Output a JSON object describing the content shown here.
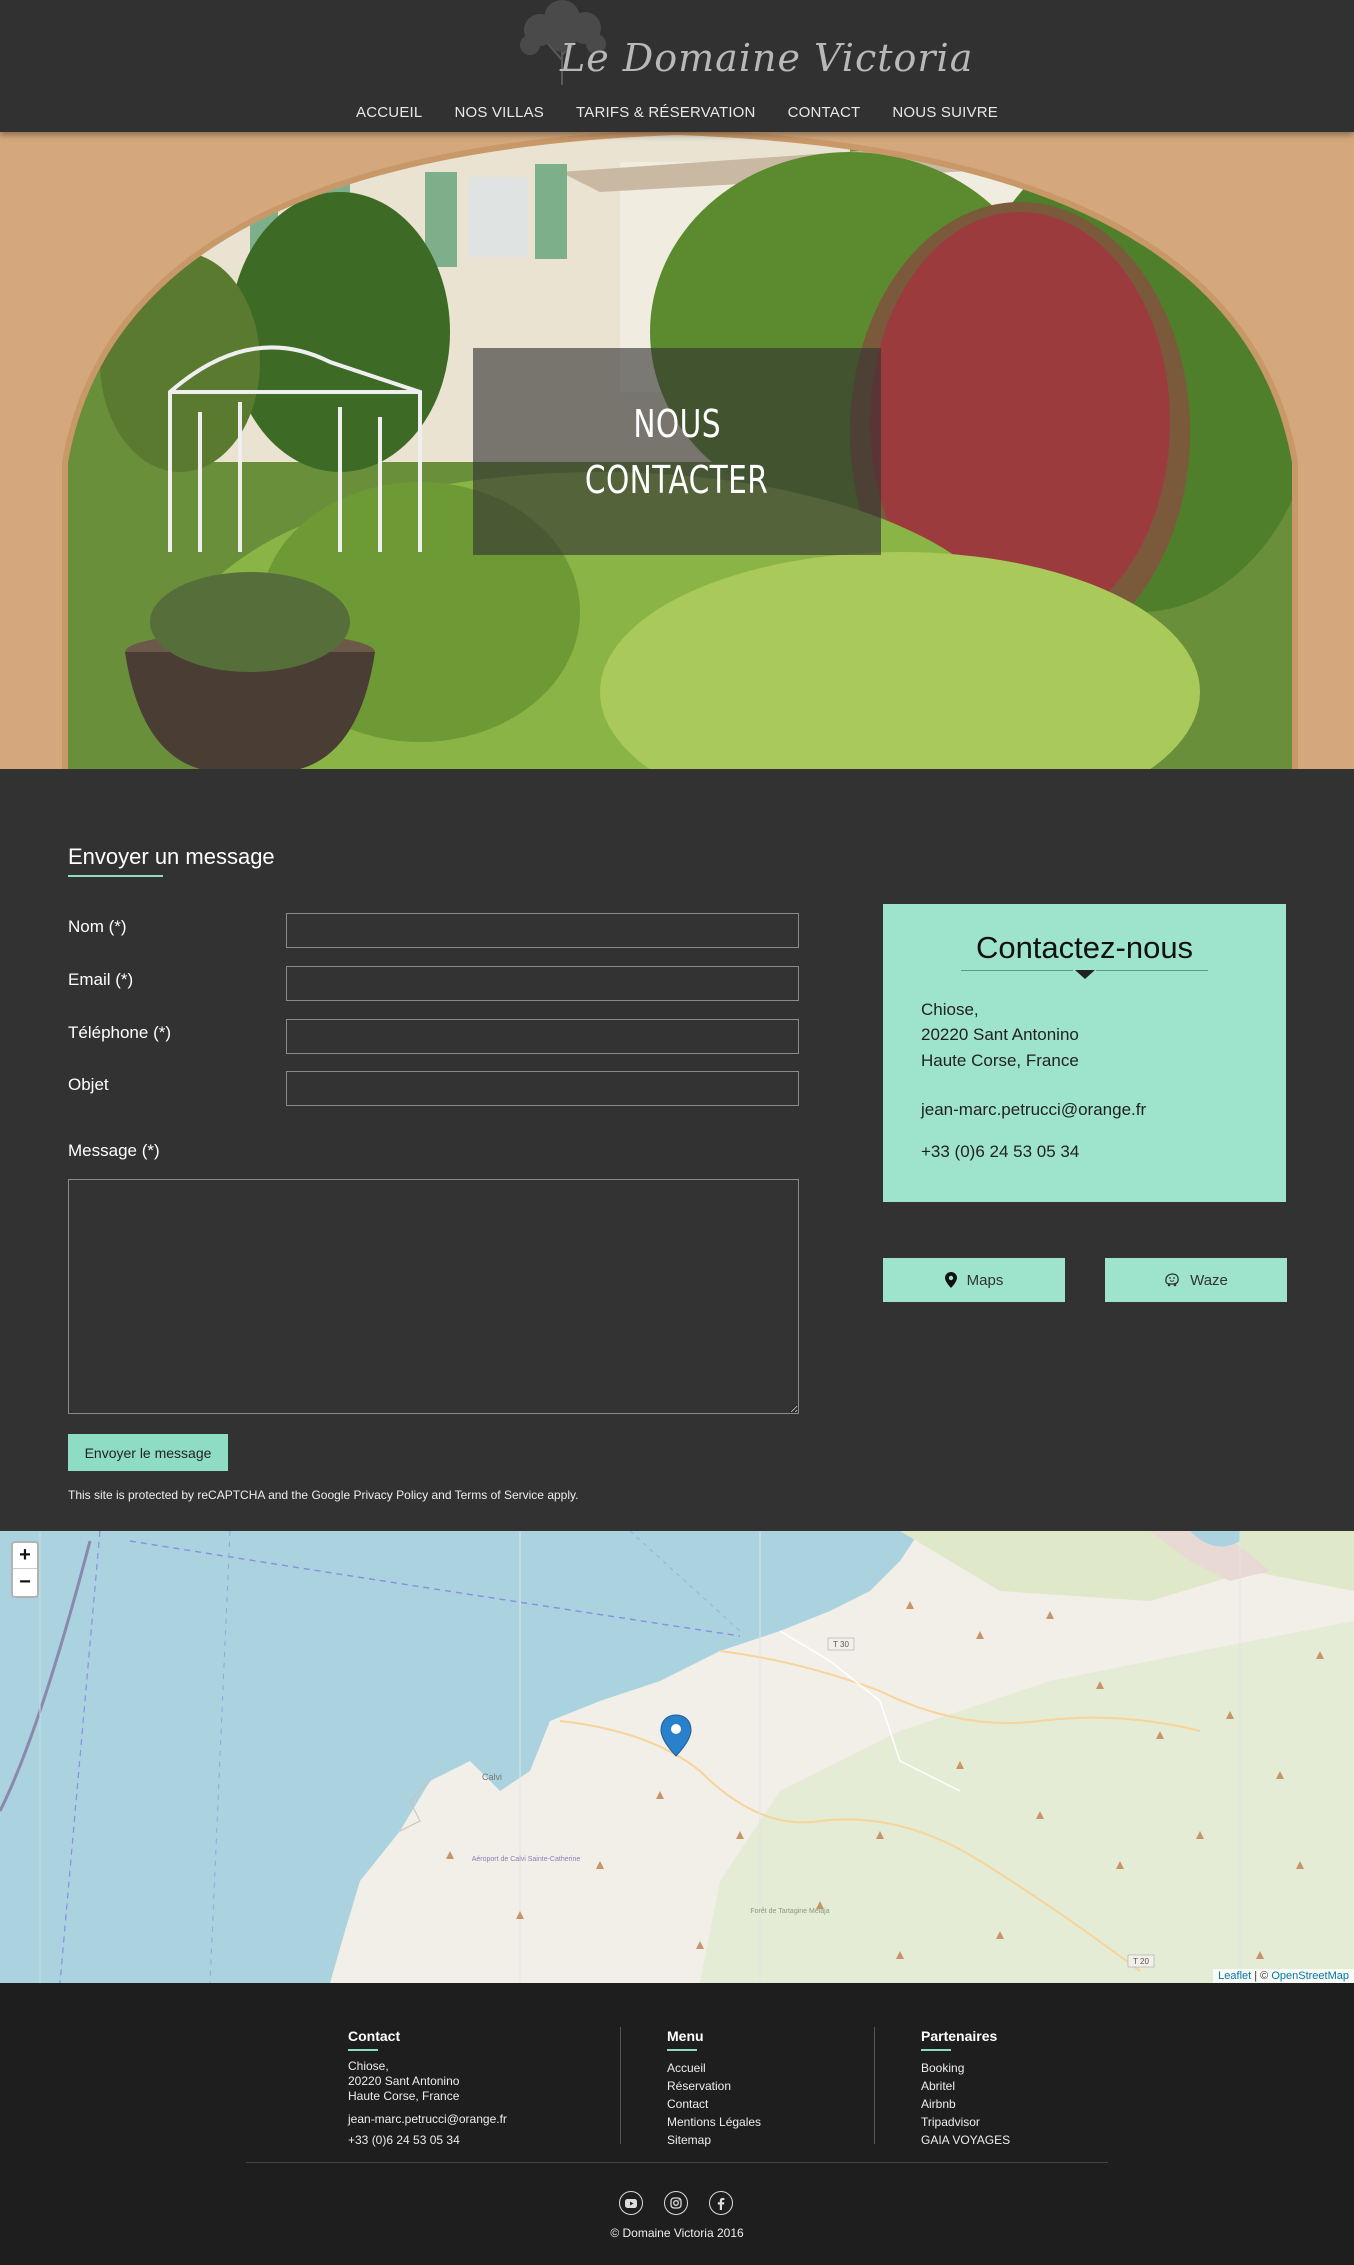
{
  "header": {
    "logo_text": "Le Domaine Victoria",
    "nav": [
      "ACCUEIL",
      "NOS VILLAS",
      "TARIFS & RÉSERVATION",
      "CONTACT",
      "NOUS SUIVRE"
    ]
  },
  "hero": {
    "title_line1": "NOUS",
    "title_line2": "CONTACTER"
  },
  "form": {
    "title": "Envoyer un message",
    "labels": {
      "nom": "Nom (*)",
      "email": "Email (*)",
      "telephone": "Téléphone (*)",
      "objet": "Objet",
      "message": "Message (*)"
    },
    "values": {
      "nom": "",
      "email": "",
      "telephone": "",
      "objet": "",
      "message": ""
    },
    "submit": "Envoyer le message",
    "recaptcha": "This site is protected by reCAPTCHA and the Google Privacy Policy and Terms of Service apply."
  },
  "contact_card": {
    "title": "Contactez-nous",
    "address_line1": "Chiose,",
    "address_line2": "20220 Sant Antonino",
    "address_line3": "Haute Corse, France",
    "email": "jean-marc.petrucci@orange.fr",
    "phone": "+33 (0)6 24 53 05 34"
  },
  "map_buttons": {
    "maps": "Maps",
    "maps_icon": "map-pin-icon",
    "waze": "Waze",
    "waze_icon": "waze-icon"
  },
  "map": {
    "zoom_in": "+",
    "zoom_out": "−",
    "attribution_leaflet": "Leaflet",
    "attribution_sep": " | © ",
    "attribution_osm": "OpenStreetMap",
    "road_labels": [
      "T 30",
      "T 20"
    ],
    "place_labels": [
      "Calvi",
      "Aéroport de Calvi Sainte-Catherine",
      "Forêt de Tartagine Melaja"
    ]
  },
  "footer": {
    "contact": {
      "title": "Contact",
      "address_line1": "Chiose,",
      "address_line2": "20220 Sant Antonino",
      "address_line3": "Haute Corse, France",
      "email": "jean-marc.petrucci@orange.fr",
      "phone": "+33 (0)6 24 53 05 34"
    },
    "menu": {
      "title": "Menu",
      "items": [
        "Accueil",
        "Réservation",
        "Contact",
        "Mentions Légales",
        "Sitemap"
      ]
    },
    "partners": {
      "title": "Partenaires",
      "items": [
        "Booking",
        "Abritel",
        "Airbnb",
        "Tripadvisor",
        "GAIA VOYAGES"
      ]
    },
    "social_icons": [
      "youtube-icon",
      "instagram-icon",
      "facebook-icon"
    ],
    "copyright": "© Domaine Victoria 2016"
  },
  "colors": {
    "accent": "#9ee3cc",
    "background": "#323232",
    "footer": "#1e1e1e"
  }
}
